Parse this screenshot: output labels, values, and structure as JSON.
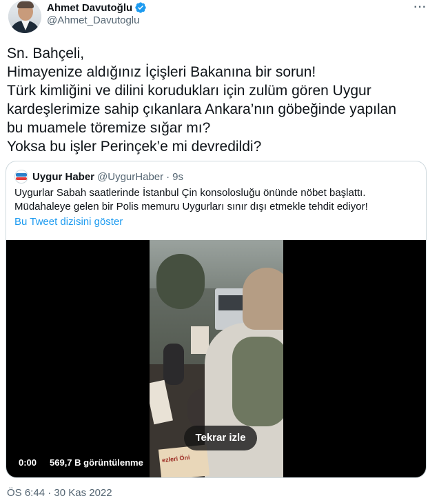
{
  "author": {
    "name": "Ahmet Davutoğlu",
    "handle": "@Ahmet_Davutoglu",
    "verified": true,
    "more_icon": "more-horizontal-icon"
  },
  "tweet": {
    "lines": [
      "Sn. Bahçeli,",
      "Himayenize aldığınız İçişleri Bakanına bir sorun!",
      "Türk kimliğini ve dilini korudukları için zulüm gören Uygur",
      "kardeşlerimize sahip çıkanlara Ankara’nın göbeğinde yapılan",
      "bu muamele töremize sığar mı?",
      "Yoksa bu işler Perinçek’e mi devredildi?"
    ]
  },
  "quote": {
    "name": "Uygur Haber",
    "handle": "@UygurHaber",
    "separator": "·",
    "time": "9s",
    "lines": [
      "Uygurlar Sabah saatlerinde İstanbul Çin konsolosluğu önünde nöbet başlattı.",
      "Müdahaleye gelen bir Polis memuru Uygurları sınır dışı etmekle tehdit ediyor!"
    ],
    "thread_link": "Bu Tweet dizisini göster",
    "video": {
      "replay_label": "Tekrar izle",
      "time": "0:00",
      "views": "569,7 B görüntülenme",
      "banner_text": "ezleri Öni"
    }
  },
  "timestamp": "ÖS 6:44 · 30 Kas 2022",
  "colors": {
    "link": "#1d9bf0",
    "secondary_text": "#536471",
    "verified_badge": "#1d9bf0",
    "border": "#cfd9de"
  }
}
